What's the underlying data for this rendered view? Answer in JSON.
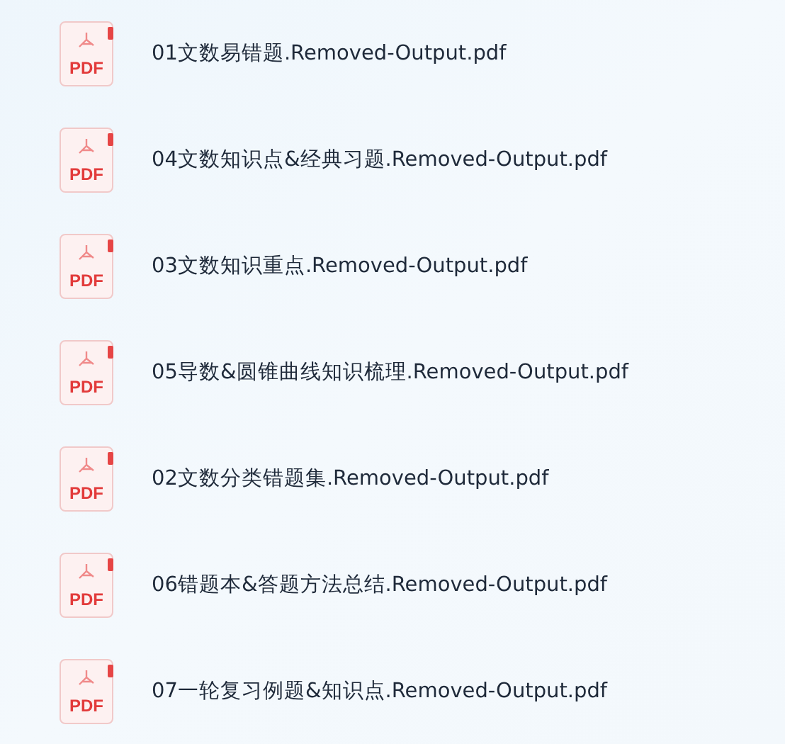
{
  "files": [
    {
      "icon_label": "PDF",
      "name": "01文数易错题.Removed-Output.pdf"
    },
    {
      "icon_label": "PDF",
      "name": "04文数知识点&经典习题.Removed-Output.pdf"
    },
    {
      "icon_label": "PDF",
      "name": "03文数知识重点.Removed-Output.pdf"
    },
    {
      "icon_label": "PDF",
      "name": "05导数&圆锥曲线知识梳理.Removed-Output.pdf"
    },
    {
      "icon_label": "PDF",
      "name": "02文数分类错题集.Removed-Output.pdf"
    },
    {
      "icon_label": "PDF",
      "name": "06错题本&答题方法总结.Removed-Output.pdf"
    },
    {
      "icon_label": "PDF",
      "name": "07一轮复习例题&知识点.Removed-Output.pdf"
    }
  ]
}
